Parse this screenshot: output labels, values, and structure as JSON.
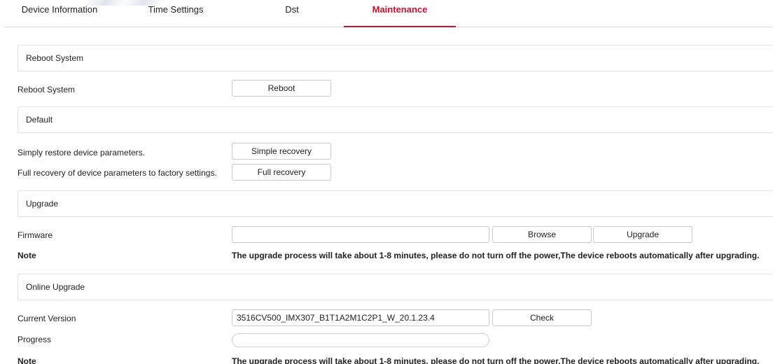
{
  "tabs": [
    {
      "label": "Device Information"
    },
    {
      "label": "Time Settings"
    },
    {
      "label": "Dst"
    },
    {
      "label": "Maintenance"
    }
  ],
  "active_tab": "Maintenance",
  "accent_color": "#c8102e",
  "reboot": {
    "section_title": "Reboot System",
    "row_label": "Reboot System",
    "button_label": "Reboot"
  },
  "default": {
    "section_title": "Default",
    "simple_label": "Simply restore device parameters.",
    "simple_button": "Simple recovery",
    "full_label": "Full recovery of device parameters to factory settings.",
    "full_button": "Full recovery"
  },
  "upgrade": {
    "section_title": "Upgrade",
    "firmware_label": "Firmware",
    "firmware_value": "",
    "browse_button": "Browse",
    "upgrade_button": "Upgrade",
    "note_label": "Note",
    "note_text": "The upgrade process will take about 1-8 minutes, please do not turn off the power,The device reboots automatically after upgrading."
  },
  "online_upgrade": {
    "section_title": "Online Upgrade",
    "current_version_label": "Current Version",
    "current_version_value": "3516CV500_IMX307_B1T1A2M1C2P1_W_20.1.23.4",
    "check_button": "Check",
    "progress_label": "Progress",
    "progress_value": 0,
    "note_label": "Note",
    "note_text": "The upgrade process will take about 1-8 minutes, please do not turn off the power,The device reboots automatically after upgrading."
  }
}
